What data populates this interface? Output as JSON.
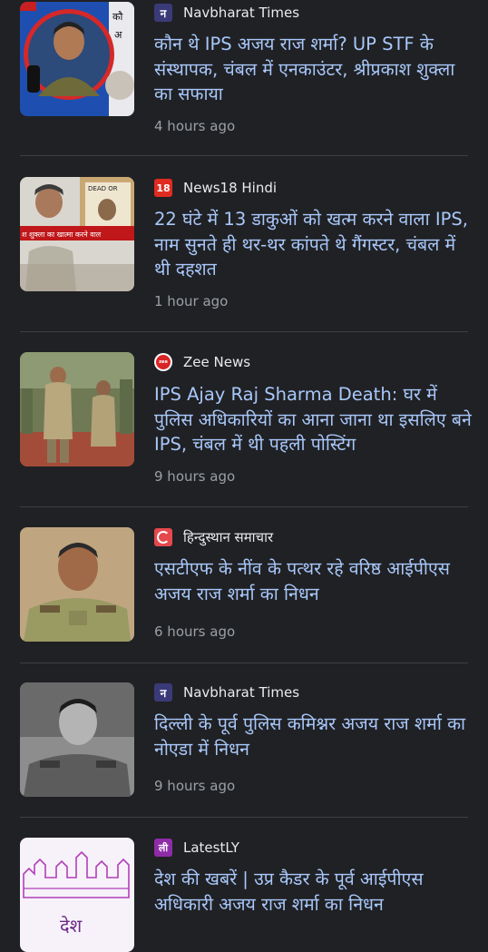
{
  "feed": {
    "items": [
      {
        "source": "Navbharat Times",
        "source_badge": "न",
        "source_icon": "navbharat-times-logo-icon",
        "headline": "कौन थे IPS अजय राज शर्मा? UP STF के संस्थापक, चंबल में एनकाउंटर, श्रीप्रकाश शुक्ला का सफाया",
        "time": "4 hours ago",
        "badge_color": "#3a3a78"
      },
      {
        "source": "News18 Hindi",
        "source_badge": "18",
        "source_icon": "news18-logo-icon",
        "headline": "22 घंटे में 13 डाकुओं को खत्म करने वाला IPS, नाम सुनते ही थर-थर कांपते थे गैंगस्टर, चंबल में थी दहशत",
        "time": "1 hour ago",
        "badge_color": "#e02b20"
      },
      {
        "source": "Zee News",
        "source_badge": "zee",
        "source_icon": "zee-news-logo-icon",
        "headline": "IPS Ajay Raj Sharma Death: घर में पुलिस अधिकारियों का आना जाना था इसलिए बने IPS, चंबल में थी पहली पोस्टिंग",
        "time": "9 hours ago",
        "badge_color": "#d92525"
      },
      {
        "source": "हिन्दुस्थान समाचार",
        "source_badge": "",
        "source_icon": "hindusthan-samachar-logo-icon",
        "headline": "एसटीएफ के नींव के पत्थर रहे वरिष्ठ आईपीएस अजय राज शर्मा का निधन",
        "time": "6 hours ago",
        "badge_color": "#e5484d"
      },
      {
        "source": "Navbharat Times",
        "source_badge": "न",
        "source_icon": "navbharat-times-logo-icon",
        "headline": "दिल्ली के पूर्व पुलिस कमिश्नर अजय राज शर्मा का नोएडा में निधन",
        "time": "9 hours ago",
        "badge_color": "#3a3a78"
      },
      {
        "source": "LatestLY",
        "source_badge": "ली",
        "source_icon": "latestly-logo-icon",
        "headline": "देश की खबरें | उप्र कैडर के पूर्व आईपीएस अधिकारी अजय राज शर्मा का निधन",
        "time": "",
        "badge_color": "#8e2ca8"
      }
    ]
  },
  "thumb_texts": {
    "t1_a": "कौ",
    "t1_b": "अ",
    "t2_banner": "श शुक्ला का खात्मा करने वाल",
    "t2_paper": "DEAD OR",
    "t6_text": "देश"
  }
}
